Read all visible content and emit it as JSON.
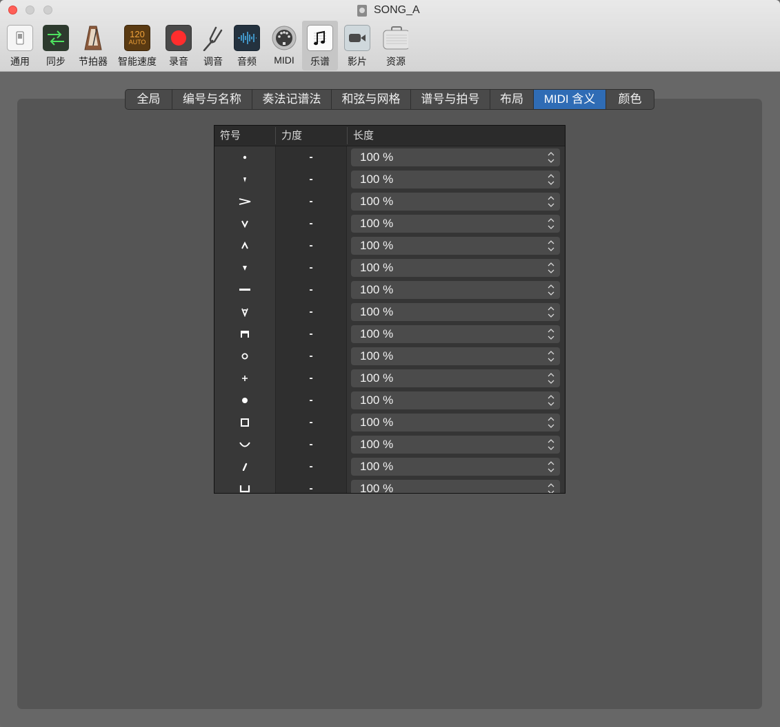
{
  "window": {
    "title": "SONG_A",
    "toolbar": [
      {
        "label": "通用",
        "icon": "switch-icon"
      },
      {
        "label": "同步",
        "icon": "sync-arrows-icon"
      },
      {
        "label": "节拍器",
        "icon": "metronome-icon"
      },
      {
        "label": "智能速度",
        "icon": "smart-tempo-icon",
        "badge_top": "120",
        "badge_bottom": "AUTO"
      },
      {
        "label": "录音",
        "icon": "record-icon"
      },
      {
        "label": "调音",
        "icon": "tuning-fork-icon"
      },
      {
        "label": "音频",
        "icon": "waveform-icon"
      },
      {
        "label": "MIDI",
        "icon": "midi-connector-icon"
      },
      {
        "label": "乐谱",
        "icon": "music-note-icon",
        "selected": true
      },
      {
        "label": "影片",
        "icon": "video-camera-icon"
      },
      {
        "label": "资源",
        "icon": "briefcase-icon"
      }
    ]
  },
  "tabs": [
    {
      "label": "全局"
    },
    {
      "label": "编号与名称"
    },
    {
      "label": "奏法记谱法"
    },
    {
      "label": "和弦与网格"
    },
    {
      "label": "谱号与拍号"
    },
    {
      "label": "布局"
    },
    {
      "label": "MIDI 含义",
      "active": true
    },
    {
      "label": "颜色"
    }
  ],
  "table": {
    "headers": {
      "symbol": "符号",
      "velocity": "力度",
      "length": "长度"
    },
    "rows": [
      {
        "symbol": "staccato-dot-icon",
        "velocity": "-",
        "length": "100 %"
      },
      {
        "symbol": "staccatissimo-icon",
        "velocity": "-",
        "length": "100 %"
      },
      {
        "symbol": "accent-icon",
        "velocity": "-",
        "length": "100 %"
      },
      {
        "symbol": "marcato-down-icon",
        "velocity": "-",
        "length": "100 %"
      },
      {
        "symbol": "marcato-up-icon",
        "velocity": "-",
        "length": "100 %"
      },
      {
        "symbol": "wedge-icon",
        "velocity": "-",
        "length": "100 %"
      },
      {
        "symbol": "tenuto-icon",
        "velocity": "-",
        "length": "100 %"
      },
      {
        "symbol": "marcato-double-icon",
        "velocity": "-",
        "length": "100 %"
      },
      {
        "symbol": "down-bow-icon",
        "velocity": "-",
        "length": "100 %"
      },
      {
        "symbol": "harmonic-circle-icon",
        "velocity": "-",
        "length": "100 %"
      },
      {
        "symbol": "plus-icon",
        "velocity": "-",
        "length": "100 %"
      },
      {
        "symbol": "filled-dot-icon",
        "velocity": "-",
        "length": "100 %"
      },
      {
        "symbol": "square-icon",
        "velocity": "-",
        "length": "100 %"
      },
      {
        "symbol": "arc-icon",
        "velocity": "-",
        "length": "100 %"
      },
      {
        "symbol": "breath-mark-icon",
        "velocity": "-",
        "length": "100 %"
      },
      {
        "symbol": "bracket-up-icon",
        "velocity": "-",
        "length": "100 %"
      }
    ]
  }
}
